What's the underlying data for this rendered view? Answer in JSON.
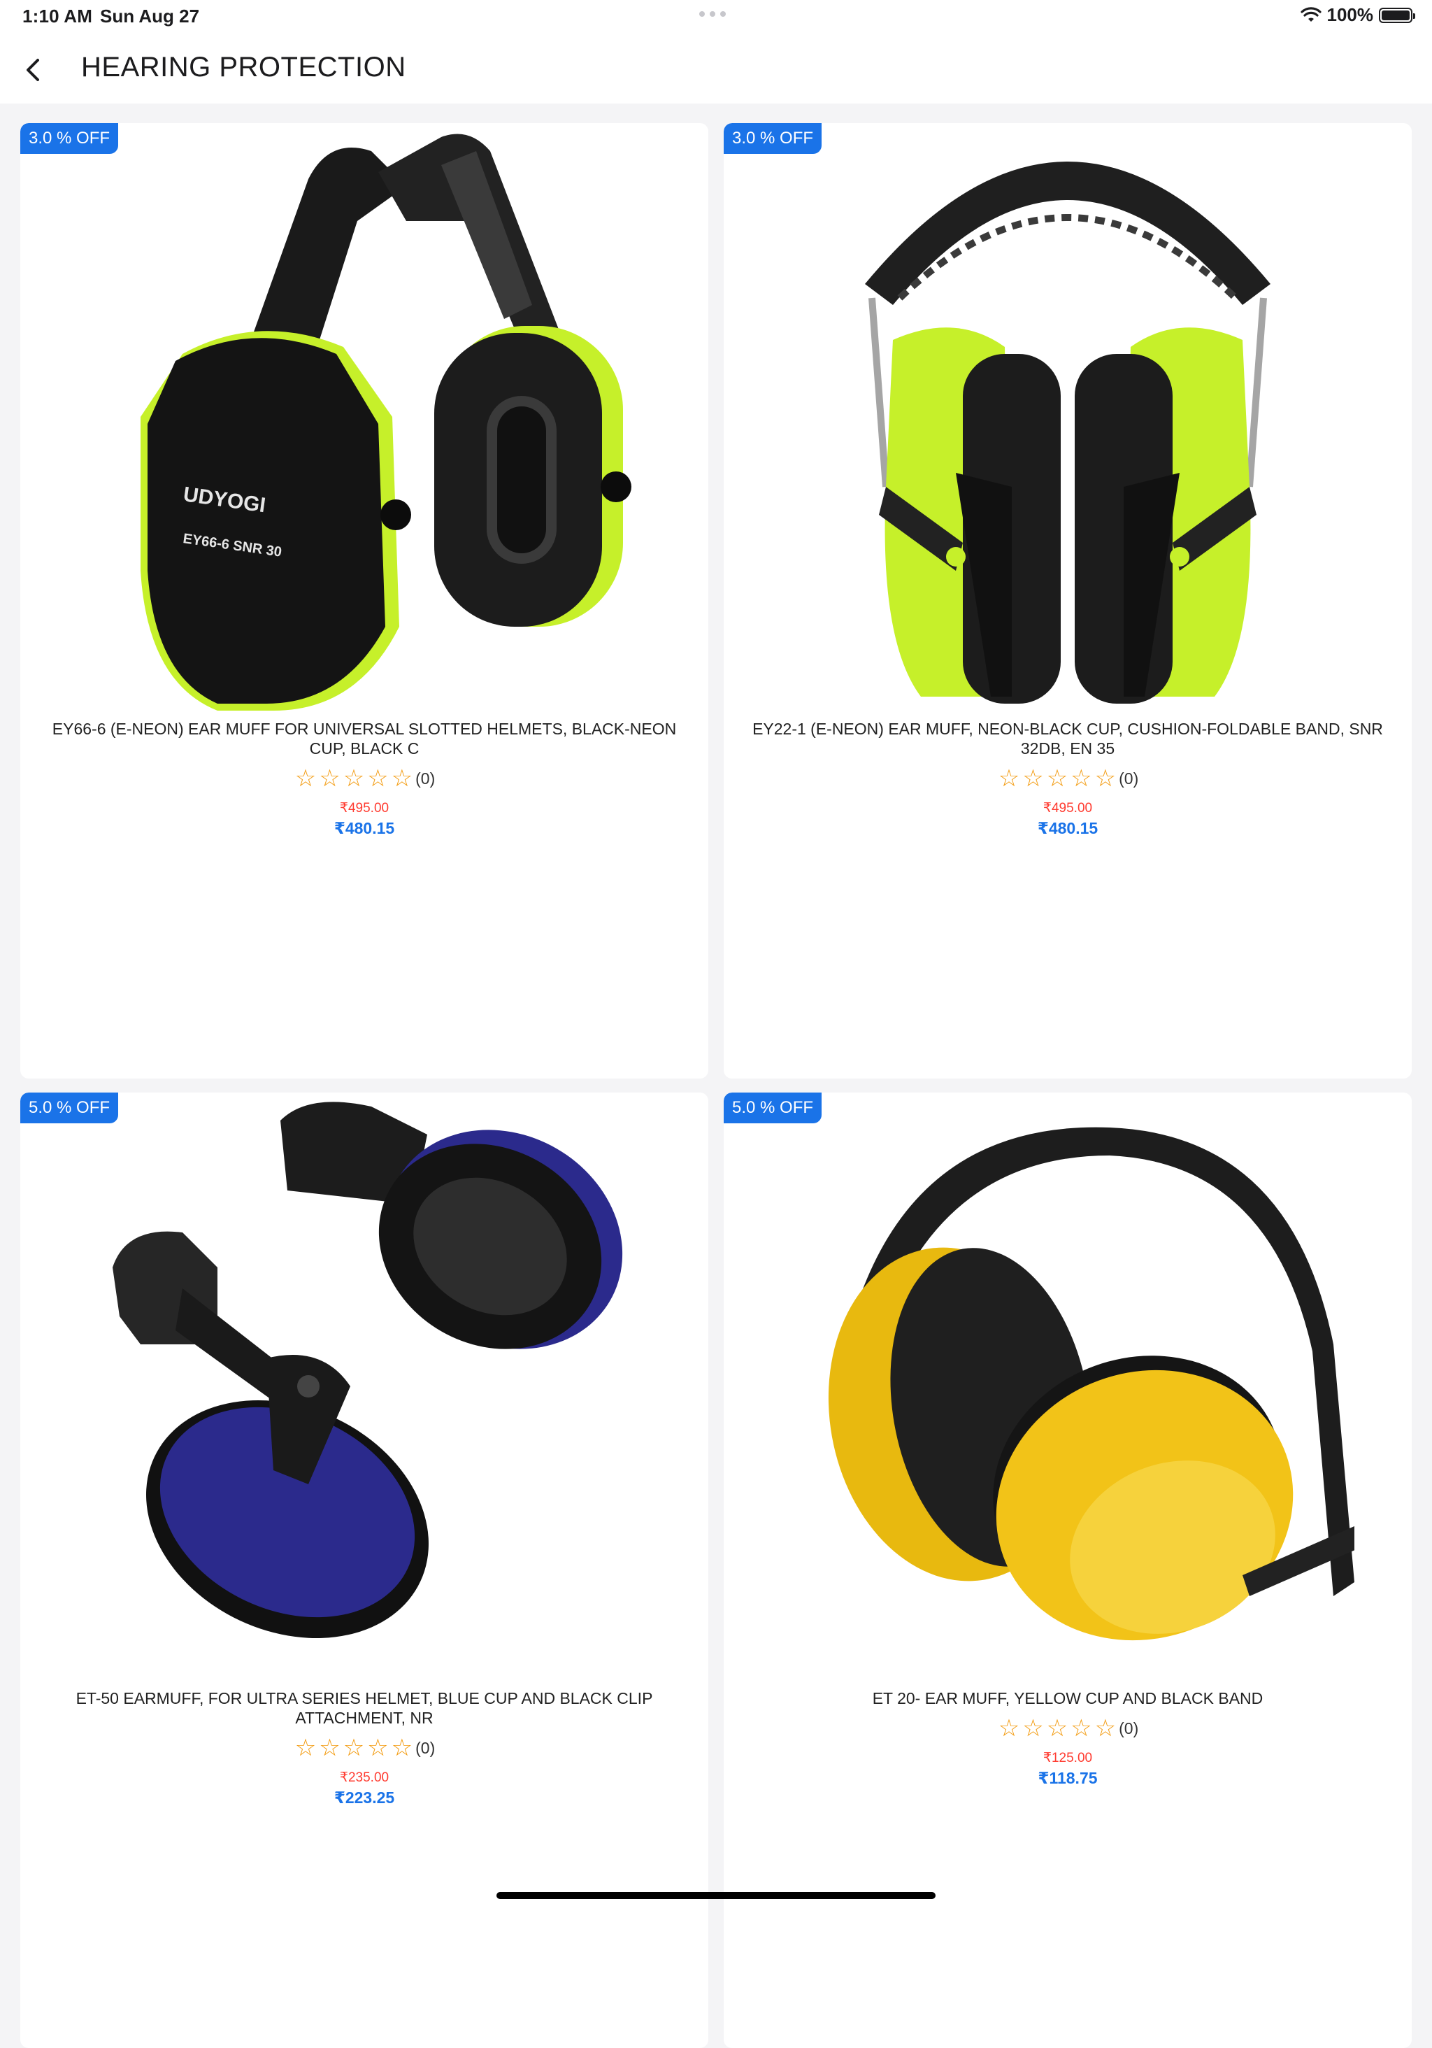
{
  "status_bar": {
    "time": "1:10 AM",
    "date": "Sun Aug 27",
    "battery": "100%",
    "battery_level": 1.0
  },
  "header": {
    "title": "HEARING PROTECTION",
    "back_icon": "chevron-left-icon"
  },
  "products": [
    {
      "discount": "3.0 % OFF",
      "name": "EY66-6 (E-NEON) EAR MUFF FOR  UNIVERSAL SLOTTED HELMETS, BLACK-NEON CUP, BLACK C",
      "rating_count": "(0)",
      "mrp": "₹495.00",
      "price": "₹480.15",
      "image_logo": "UDYOGI",
      "image_text": "EY66-6  SNR 30"
    },
    {
      "discount": "3.0 % OFF",
      "name": "EY22-1 (E-NEON) EAR MUFF, NEON-BLACK CUP, CUSHION-FOLDABLE BAND, SNR 32DB, EN 35",
      "rating_count": "(0)",
      "mrp": "₹495.00",
      "price": "₹480.15"
    },
    {
      "discount": "5.0 % OFF",
      "name": "ET-50 EARMUFF, FOR ULTRA SERIES HELMET, BLUE CUP AND BLACK  CLIP ATTACHMENT, NR",
      "rating_count": "(0)",
      "mrp": "₹235.00",
      "price": "₹223.25"
    },
    {
      "discount": "5.0 % OFF",
      "name": "ET 20- EAR MUFF, YELLOW CUP AND BLACK BAND",
      "rating_count": "(0)",
      "mrp": "₹125.00",
      "price": "₹118.75"
    }
  ],
  "colors": {
    "accent": "#1a73e8",
    "mrp_red": "#ff3b30",
    "star": "#f39c12",
    "neon": "#c6f02a",
    "blue_cup": "#2b2a8c",
    "yellow_cup": "#f2c318"
  }
}
